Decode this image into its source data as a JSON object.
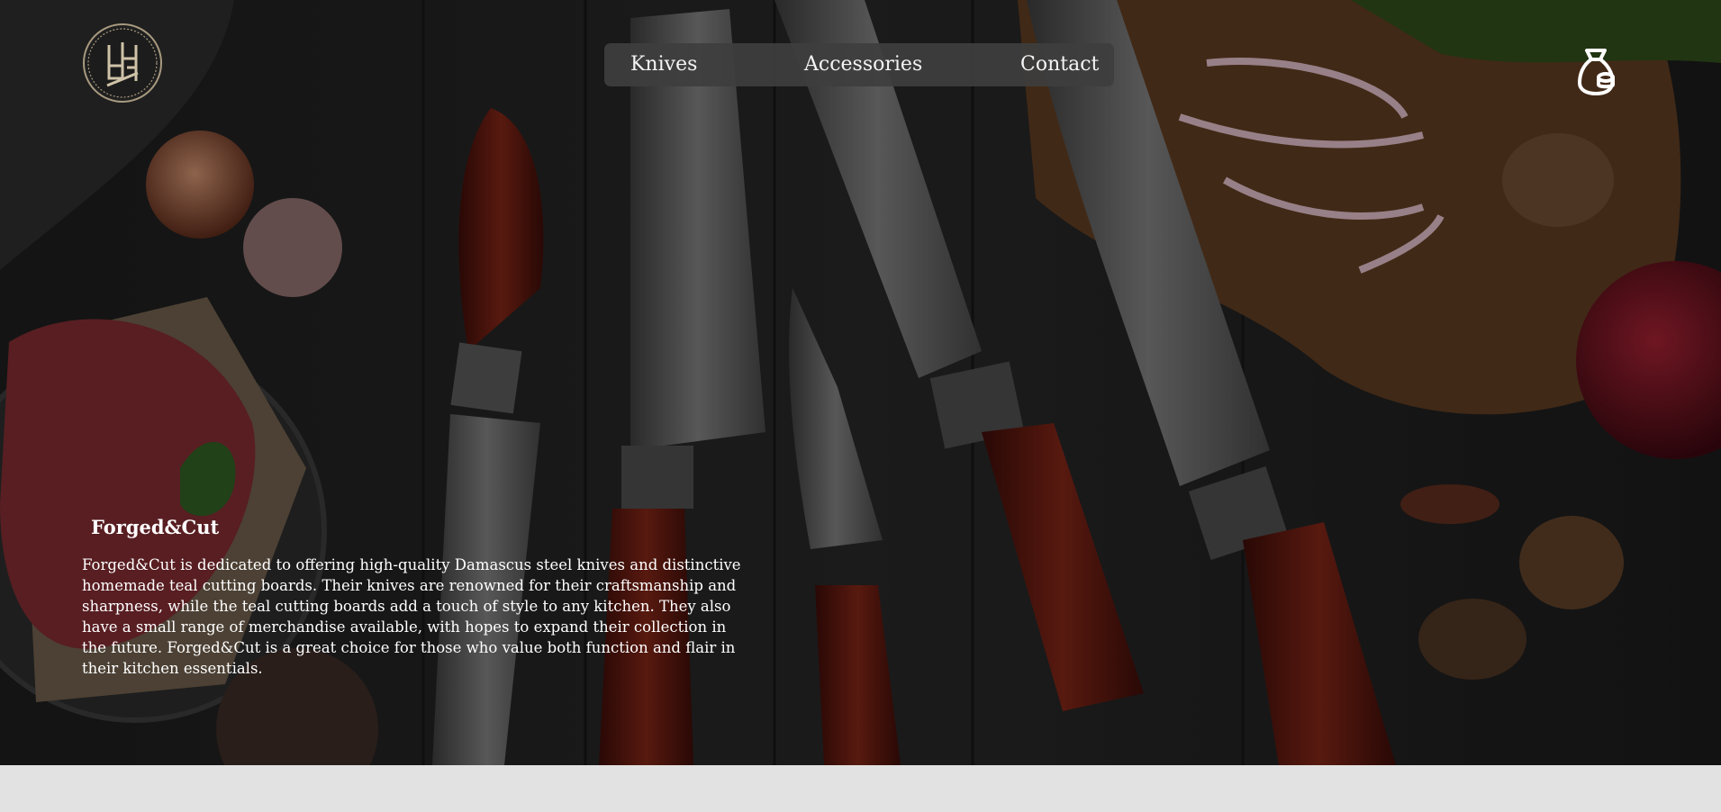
{
  "brand": {
    "name": "Forged&Cut",
    "logo_icon": "knot-emblem-logo"
  },
  "nav": {
    "items": [
      {
        "label": "Knives"
      },
      {
        "label": "Accessories"
      },
      {
        "label": "Contact"
      }
    ]
  },
  "header": {
    "cart_icon": "shopping-bag-icon"
  },
  "hero": {
    "title": "Forged&Cut",
    "description": "Forged&Cut is dedicated to offering high-quality Damascus steel knives and distinctive homemade teal cutting boards. Their knives are renowned for their craftsmanship and sharpness, while the teal cutting boards add a touch of style to any kitchen. They also have a small range of merchandise available, with hopes to expand their collection in the future. Forged&Cut is a great choice for those who value both function and flair in their kitchen essentials.",
    "background": "dark-wood-table-with-knives-onions-meat"
  },
  "colors": {
    "page_bg": "#e2e2e2",
    "nav_bg": "#3e3e3e",
    "text": "#ffffff",
    "handle_wood": "#6b1a12"
  }
}
